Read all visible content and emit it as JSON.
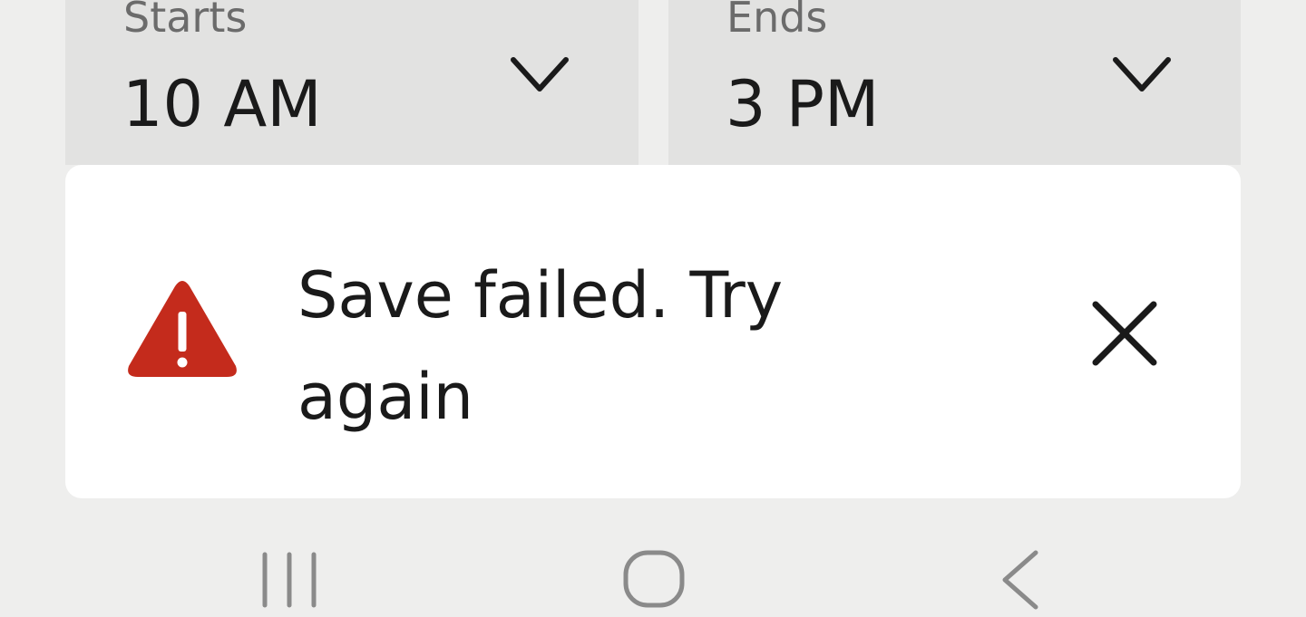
{
  "schedule": {
    "starts": {
      "label": "Starts",
      "value": "10 AM",
      "icon": "chevron-down-icon"
    },
    "ends": {
      "label": "Ends",
      "value": "3 PM",
      "icon": "chevron-down-icon"
    }
  },
  "toast": {
    "icon": "warning-triangle-icon",
    "icon_color": "#c42b1c",
    "message": "Save failed. Try again",
    "close_icon": "close-icon"
  },
  "navbar": {
    "recents_icon": "recents-icon",
    "home_icon": "home-icon",
    "back_icon": "back-icon"
  }
}
